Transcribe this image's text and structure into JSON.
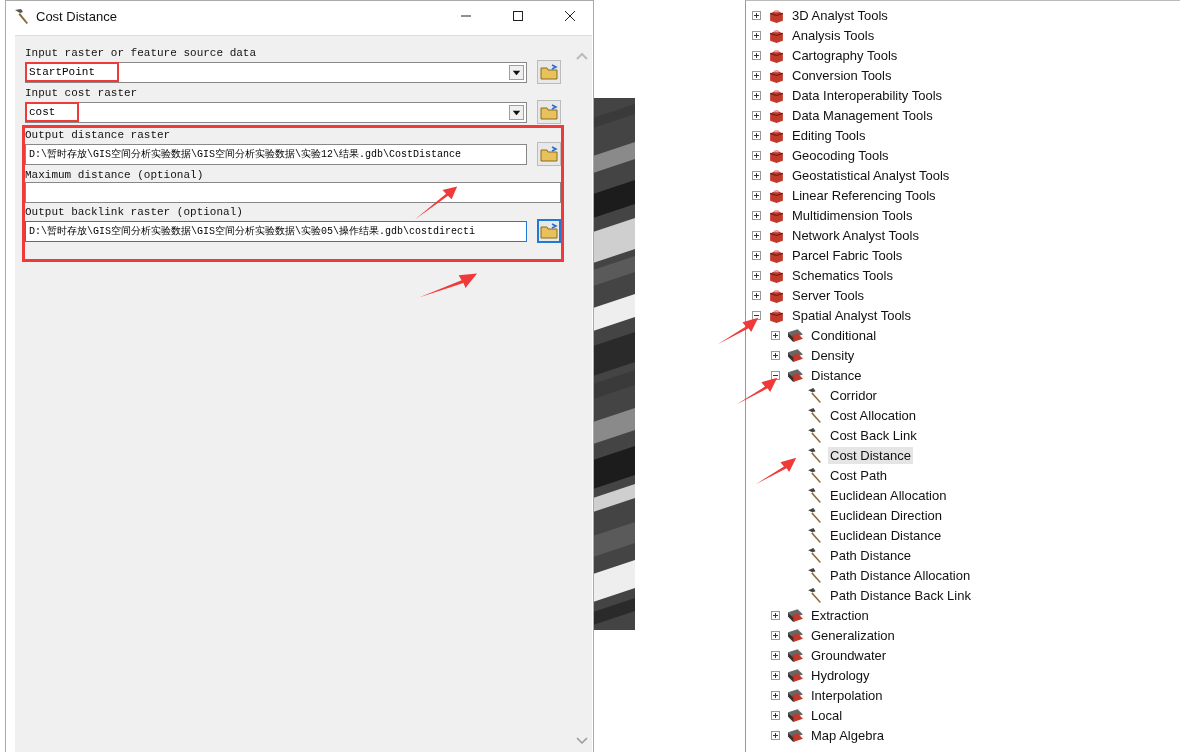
{
  "dialog": {
    "title": "Cost Distance",
    "groups": [
      {
        "marked": false,
        "fields": [
          {
            "label": "Input raster or feature source data",
            "value": "StartPoint",
            "kind": "dropdown",
            "marked": true,
            "focused": false
          },
          {
            "label": "Input cost raster",
            "value": "cost",
            "kind": "dropdown",
            "marked": true,
            "focused": false
          }
        ]
      },
      {
        "marked": true,
        "fields": [
          {
            "label": "Output distance raster",
            "value": "D:\\暂时存放\\GIS空间分析实验数据\\GIS空间分析实验数据\\实验12\\结果.gdb\\CostDistance",
            "kind": "path",
            "marked": false,
            "focused": false
          },
          {
            "label": "Maximum distance (optional)",
            "kind": "text",
            "marked": false,
            "focused": false
          },
          {
            "label": "Output backlink raster (optional)",
            "value": "D:\\暂时存放\\GIS空间分析实验数据\\GIS空间分析实验数据\\实验05\\操作结果.gdb\\costdirecti",
            "kind": "path",
            "marked": false,
            "focused": true
          }
        ]
      }
    ]
  },
  "toolbox_tree": [
    {
      "label": "3D Analyst Tools",
      "kind": "toolbox",
      "expanded": false,
      "marked": false
    },
    {
      "label": "Analysis Tools",
      "kind": "toolbox",
      "expanded": false,
      "marked": false
    },
    {
      "label": "Cartography Tools",
      "kind": "toolbox",
      "expanded": false,
      "marked": false
    },
    {
      "label": "Conversion Tools",
      "kind": "toolbox",
      "expanded": false,
      "marked": false
    },
    {
      "label": "Data Interoperability Tools",
      "kind": "toolbox",
      "expanded": false,
      "marked": false
    },
    {
      "label": "Data Management Tools",
      "kind": "toolbox",
      "expanded": false,
      "marked": false
    },
    {
      "label": "Editing Tools",
      "kind": "toolbox",
      "expanded": false,
      "marked": false
    },
    {
      "label": "Geocoding Tools",
      "kind": "toolbox",
      "expanded": false,
      "marked": false
    },
    {
      "label": "Geostatistical Analyst Tools",
      "kind": "toolbox",
      "expanded": false,
      "marked": false
    },
    {
      "label": "Linear Referencing Tools",
      "kind": "toolbox",
      "expanded": false,
      "marked": false
    },
    {
      "label": "Multidimension Tools",
      "kind": "toolbox",
      "expanded": false,
      "marked": false
    },
    {
      "label": "Network Analyst Tools",
      "kind": "toolbox",
      "expanded": false,
      "marked": false
    },
    {
      "label": "Parcel Fabric Tools",
      "kind": "toolbox",
      "expanded": false,
      "marked": false
    },
    {
      "label": "Schematics Tools",
      "kind": "toolbox",
      "expanded": false,
      "marked": false
    },
    {
      "label": "Server Tools",
      "kind": "toolbox",
      "expanded": false,
      "marked": false
    },
    {
      "label": "Spatial Analyst Tools",
      "kind": "toolbox",
      "expanded": true,
      "marked": true,
      "children": [
        {
          "label": "Conditional",
          "kind": "toolset",
          "expanded": false,
          "marked": false
        },
        {
          "label": "Density",
          "kind": "toolset",
          "expanded": false,
          "marked": false
        },
        {
          "label": "Distance",
          "kind": "toolset",
          "expanded": true,
          "marked": true,
          "children": [
            {
              "label": "Corridor",
              "kind": "tool",
              "selected": false,
              "marked": false
            },
            {
              "label": "Cost Allocation",
              "kind": "tool",
              "selected": false,
              "marked": false
            },
            {
              "label": "Cost Back Link",
              "kind": "tool",
              "selected": false,
              "marked": false
            },
            {
              "label": "Cost Distance",
              "kind": "tool",
              "selected": true,
              "marked": true
            },
            {
              "label": "Cost Path",
              "kind": "tool",
              "selected": false,
              "marked": false
            },
            {
              "label": "Euclidean Allocation",
              "kind": "tool",
              "selected": false,
              "marked": false
            },
            {
              "label": "Euclidean Direction",
              "kind": "tool",
              "selected": false,
              "marked": false
            },
            {
              "label": "Euclidean Distance",
              "kind": "tool",
              "selected": false,
              "marked": false
            },
            {
              "label": "Path Distance",
              "kind": "tool",
              "selected": false,
              "marked": false
            },
            {
              "label": "Path Distance Allocation",
              "kind": "tool",
              "selected": false,
              "marked": false
            },
            {
              "label": "Path Distance Back Link",
              "kind": "tool",
              "selected": false,
              "marked": false
            }
          ]
        },
        {
          "label": "Extraction",
          "kind": "toolset",
          "expanded": false,
          "marked": false
        },
        {
          "label": "Generalization",
          "kind": "toolset",
          "expanded": false,
          "marked": false
        },
        {
          "label": "Groundwater",
          "kind": "toolset",
          "expanded": false,
          "marked": false
        },
        {
          "label": "Hydrology",
          "kind": "toolset",
          "expanded": false,
          "marked": false
        },
        {
          "label": "Interpolation",
          "kind": "toolset",
          "expanded": false,
          "marked": false
        },
        {
          "label": "Local",
          "kind": "toolset",
          "expanded": false,
          "marked": false
        },
        {
          "label": "Map Algebra",
          "kind": "toolset",
          "expanded": false,
          "marked": false
        }
      ]
    }
  ]
}
